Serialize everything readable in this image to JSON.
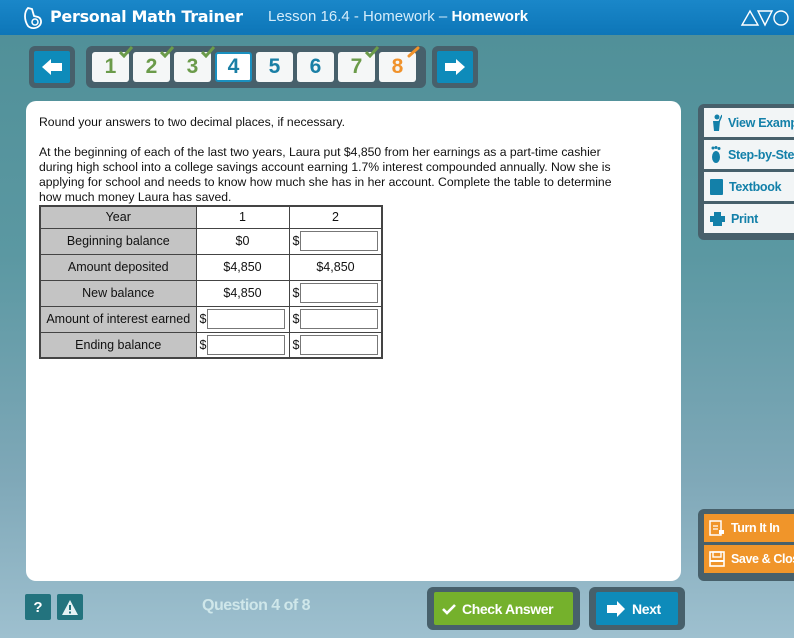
{
  "header": {
    "app_title": "Personal Math Trainer",
    "lesson": "Lesson 16.4 - Homework",
    "separator": " – ",
    "assignment": "Homework",
    "brand_icon": "triangle-shield-circle-logo"
  },
  "nav": {
    "prev_icon": "arrow-left-icon",
    "next_icon": "arrow-right-icon",
    "current": 4,
    "questions": [
      {
        "label": "1",
        "status": "correct"
      },
      {
        "label": "2",
        "status": "correct"
      },
      {
        "label": "3",
        "status": "correct"
      },
      {
        "label": "4",
        "status": "current"
      },
      {
        "label": "5",
        "status": "unanswered"
      },
      {
        "label": "6",
        "status": "unanswered"
      },
      {
        "label": "7",
        "status": "correct"
      },
      {
        "label": "8",
        "status": "partial"
      }
    ]
  },
  "question": {
    "instructions": "Round your answers to two decimal places, if necessary.",
    "problem": "At the beginning of each of the last two years, Laura put $4,850 from her earnings as a part-time cashier during high school into a college savings account earning 1.7% interest compounded annually. Now she is applying for school and needs to know how much she has in her account. Complete the table to determine how much money Laura has saved.",
    "table": {
      "header": [
        "Year",
        "1",
        "2"
      ],
      "currency_prefix": "$",
      "rows": [
        {
          "label": "Beginning balance",
          "y1": "$0",
          "y1_input": false,
          "y2": "",
          "y2_input": true
        },
        {
          "label": "Amount deposited",
          "y1": "$4,850",
          "y1_input": false,
          "y2": "$4,850",
          "y2_input": false
        },
        {
          "label": "New balance",
          "y1": "$4,850",
          "y1_input": false,
          "y2": "",
          "y2_input": true
        },
        {
          "label": "Amount of interest earned",
          "y1": "",
          "y1_input": true,
          "y2": "",
          "y2_input": true
        },
        {
          "label": "Ending balance",
          "y1": "",
          "y1_input": true,
          "y2": "",
          "y2_input": true
        }
      ]
    }
  },
  "tools": [
    {
      "label": "View Example",
      "icon": "teacher-icon"
    },
    {
      "label": "Step-by-Step",
      "icon": "footprints-icon"
    },
    {
      "label": "Textbook",
      "icon": "book-icon"
    },
    {
      "label": "Print",
      "icon": "printer-icon"
    }
  ],
  "actions": [
    {
      "label": "Turn It In",
      "icon": "turn-in-icon"
    },
    {
      "label": "Save & Close",
      "icon": "floppy-disk-icon"
    }
  ],
  "footer": {
    "help_label": "?",
    "question_count": "Question 4 of 8",
    "check_answer": "Check Answer",
    "next": "Next"
  },
  "colors": {
    "header_blue": "#0d76b8",
    "nav_blue": "#0e8bba",
    "correct_green": "#6b9b4a",
    "partial_orange": "#f0922b",
    "check_green": "#75b12c",
    "action_orange": "#f0952a",
    "frame_gray": "#47606b"
  }
}
